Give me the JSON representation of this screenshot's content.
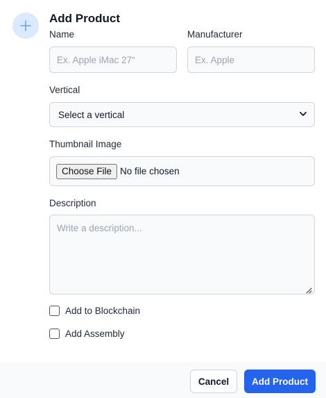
{
  "dialog": {
    "title": "Add Product",
    "icon": "plus-icon",
    "accent_color": "#2563eb",
    "icon_bg_color": "#dbeafe"
  },
  "form": {
    "name": {
      "label": "Name",
      "placeholder": "Ex. Apple iMac 27“",
      "value": ""
    },
    "manufacturer": {
      "label": "Manufacturer",
      "placeholder": "Ex. Apple",
      "value": ""
    },
    "vertical": {
      "label": "Vertical",
      "selected": "Select a vertical"
    },
    "thumbnail": {
      "label": "Thumbnail Image",
      "button_label": "Choose File",
      "status": "No file chosen"
    },
    "description": {
      "label": "Description",
      "placeholder": "Write a description...",
      "value": ""
    },
    "add_to_blockchain": {
      "label": "Add to Blockchain",
      "checked": false
    },
    "add_assembly": {
      "label": "Add Assembly",
      "checked": false
    }
  },
  "footer": {
    "cancel_label": "Cancel",
    "submit_label": "Add Product"
  }
}
